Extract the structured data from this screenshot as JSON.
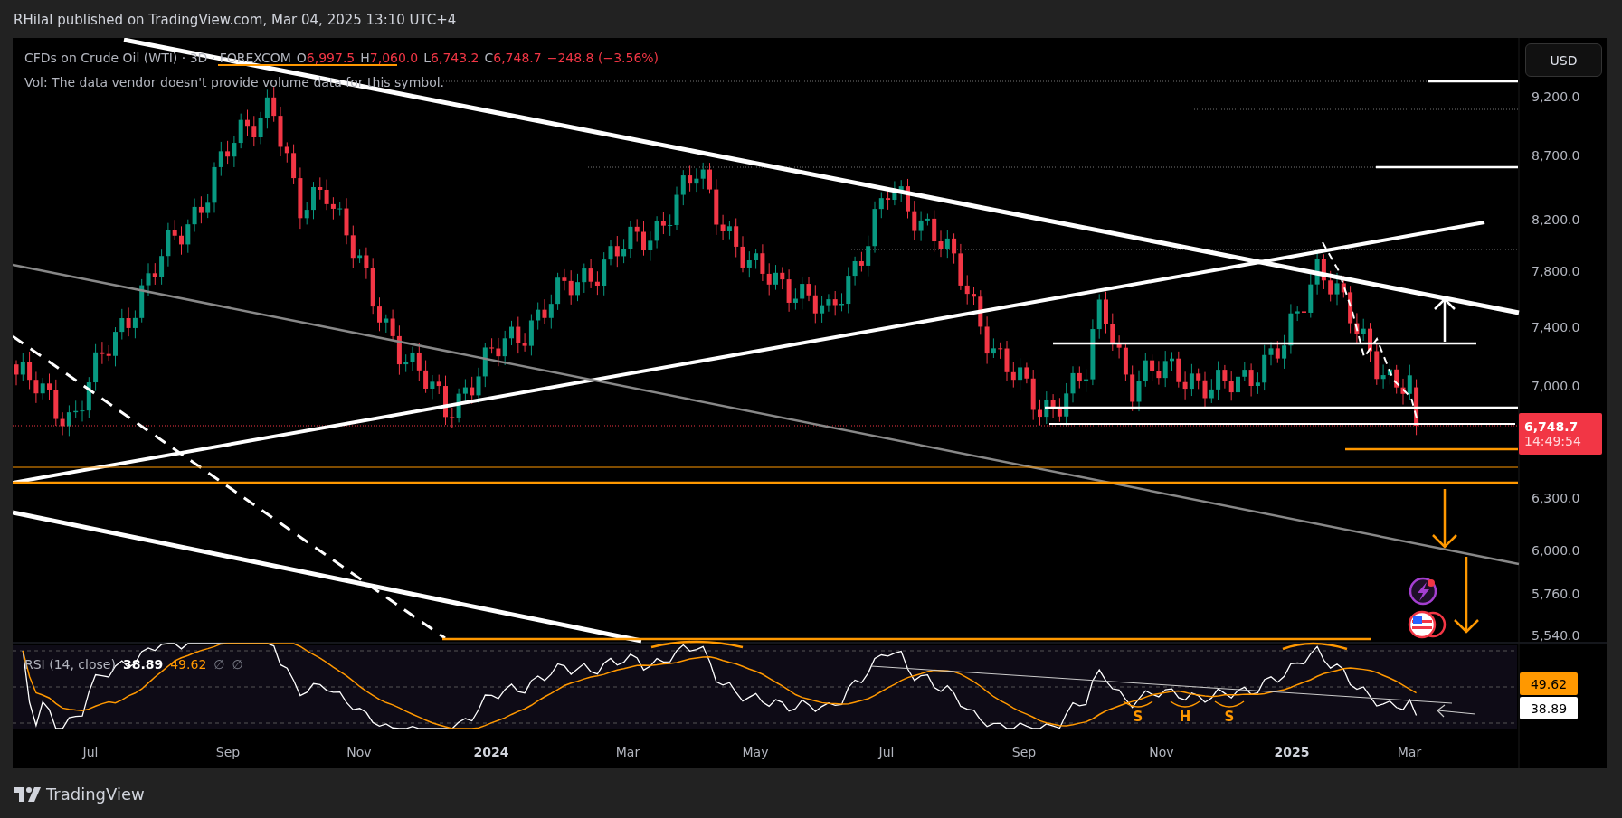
{
  "header": {
    "publisher_line": "RHilal published on TradingView.com, Mar 04, 2025 13:10 UTC+4"
  },
  "legend": {
    "symbol": "CFDs on Crude Oil (WTI) · 3D · FOREXCOM",
    "ohlc": [
      {
        "key": "O",
        "value": "6,997.5"
      },
      {
        "key": "H",
        "value": "7,060.0"
      },
      {
        "key": "L",
        "value": "6,743.2"
      },
      {
        "key": "C",
        "value": "6,748.7"
      }
    ],
    "change": "−248.8 (−3.56%)",
    "volume_note": "Vol: The data vendor doesn't provide volume data for this symbol."
  },
  "currency_button": "USD",
  "price_axis": [
    "9,200.0",
    "8,700.0",
    "8,200.0",
    "7,800.0",
    "7,400.0",
    "7,000.0",
    "6,300.0",
    "6,000.0",
    "5,760.0",
    "5,540.0"
  ],
  "last_price": {
    "price": "6,748.7",
    "countdown": "14:49:54"
  },
  "rsi": {
    "title": "RSI (14, close)",
    "value": "38.89",
    "ma_value": "49.62",
    "extras": [
      "∅",
      "∅"
    ],
    "axis_labels": [
      {
        "text": "49.62",
        "kind": "ma"
      },
      {
        "text": "38.89",
        "kind": "rsi"
      }
    ]
  },
  "pattern_labels": [
    "S",
    "H",
    "S"
  ],
  "time_axis": [
    {
      "label": "Jul",
      "kind": "month"
    },
    {
      "label": "Sep",
      "kind": "month"
    },
    {
      "label": "Nov",
      "kind": "month"
    },
    {
      "label": "2024",
      "kind": "year"
    },
    {
      "label": "Mar",
      "kind": "month"
    },
    {
      "label": "May",
      "kind": "month"
    },
    {
      "label": "Jul",
      "kind": "month"
    },
    {
      "label": "Sep",
      "kind": "month"
    },
    {
      "label": "Nov",
      "kind": "month"
    },
    {
      "label": "2025",
      "kind": "year"
    },
    {
      "label": "Mar",
      "kind": "month"
    }
  ],
  "footer": {
    "brand": "TradingView"
  }
}
